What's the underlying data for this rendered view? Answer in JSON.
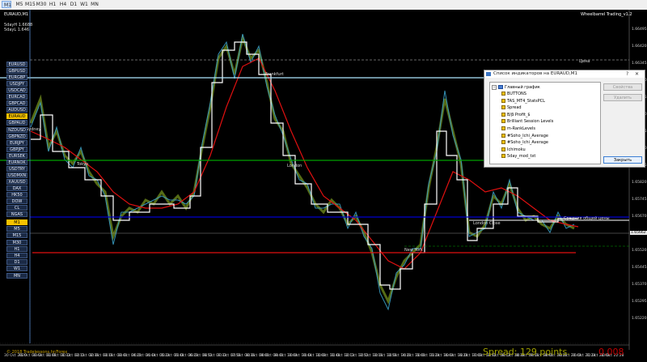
{
  "toolbar": {
    "timeframes": [
      "M1",
      "M5",
      "M15",
      "M30",
      "H1",
      "H4",
      "D1",
      "W1",
      "MN"
    ],
    "active": "M1"
  },
  "chart": {
    "symbol_title": "EURAUD,M1",
    "stats": [
      "5dayH 1.6688",
      "5dayL 1.646"
    ],
    "indicator_title": "Wheelbarrel Trading_v1.2",
    "symbols": [
      "EURUSD",
      "GBPUSD",
      "EURGBP",
      "USDJPY",
      "USDCAD",
      "EURCAD",
      "GBPCAD",
      "AUDUSD",
      "EURAUD",
      "GBPAUD",
      "NZDUSD",
      "GBPNZD",
      "EURJPY",
      "GBPJPY",
      "EURSEK",
      "EURNOK",
      "USDTRY",
      "USDMXN",
      "XAUUSD",
      "DAX",
      "HK50",
      "DOW",
      "CL",
      "NGAS"
    ],
    "active_symbol": "EURAUD",
    "timeframe_buttons": [
      "M1",
      "M5",
      "M15",
      "M30",
      "H1",
      "H4",
      "D1",
      "W1",
      "MN"
    ],
    "active_timeframe": "M1",
    "session_labels": {
      "sydney": "Sydney",
      "tokyo": "Tokyo",
      "frankfurt": "Frankfurt",
      "london": "London",
      "london_close": "London Close",
      "new_york": "New York"
    },
    "level_labels": {
      "price": "Цена",
      "avg_price": "Средняя общей цены"
    },
    "y_axis": [
      "1.66495",
      "1.66420",
      "1.66345",
      "1.66270",
      "1.66195",
      "1.66120",
      "1.66045",
      "1.65970",
      "1.65895",
      "1.65820",
      "1.65745",
      "1.65670",
      "1.65662",
      "1.65595",
      "1.65520",
      "1.65445",
      "1.65370",
      "1.65295",
      "1.65220"
    ],
    "current_price": "1.65662",
    "x_axis": [
      "30 Oct 2020",
      "30 Oct 00:44",
      "30 Oct 01:08",
      "30 Oct 01:32",
      "30 Oct 02:12",
      "30 Oct 02:36",
      "30 Oct 03:16",
      "30 Oct 03:40",
      "30 Oct 04:20",
      "30 Oct 04:44",
      "30 Oct 05:24",
      "30 Oct 05:48",
      "30 Oct 06:28",
      "30 Oct 06:52",
      "30 Oct 07:32",
      "30 Oct 07:56",
      "30 Oct 08:36",
      "30 Oct 09:00",
      "30 Oct 09:40",
      "30 Oct 10:04",
      "30 Oct 10:44",
      "30 Oct 11:08",
      "30 Oct 11:48",
      "30 Oct 12:12",
      "30 Oct 12:52",
      "30 Oct 13:16",
      "30 Oct 13:56",
      "30 Oct 14:20",
      "30 Oct 15:00",
      "30 Oct 15:24",
      "30 Oct 16:04",
      "30 Oct 16:28",
      "30 Oct 17:08",
      "30 Oct 17:32",
      "30 Oct 18:12",
      "30 Oct 18:36",
      "30 Oct 19:16",
      "30 Oct 19:40",
      "30 Oct 20:20",
      "30 Oct 20:44",
      "30 Oct 21:24",
      "30 Oct 21:48",
      "30 Oct 22:28"
    ],
    "spread_label": "Spread: 129 points.",
    "spread_value": "0.008",
    "copyright": "© 2018 Tradelessons.hr/Forex"
  },
  "dialog": {
    "title": "Список индикаторов на EURAUD,M1",
    "help": "?",
    "close": "✕",
    "root": "Главный график",
    "items": [
      "BUTTONS",
      "TAS_MT4_StatsPCL",
      "Spread",
      "B/β Profit_$",
      "Brilliant Session Levels",
      "m-RankLevels",
      "#Soho_Ichi_Average",
      "#Soho_Ichi_Average",
      "Ichimoku",
      "5day_mod_txt"
    ],
    "buttons": {
      "properties": "Свойства",
      "delete": "Удалить",
      "close": "Закрыть"
    }
  },
  "colors": {
    "active": "#f5c200",
    "bg": "#000000",
    "red_ma": "#e01010",
    "white_line": "#ffffff"
  }
}
